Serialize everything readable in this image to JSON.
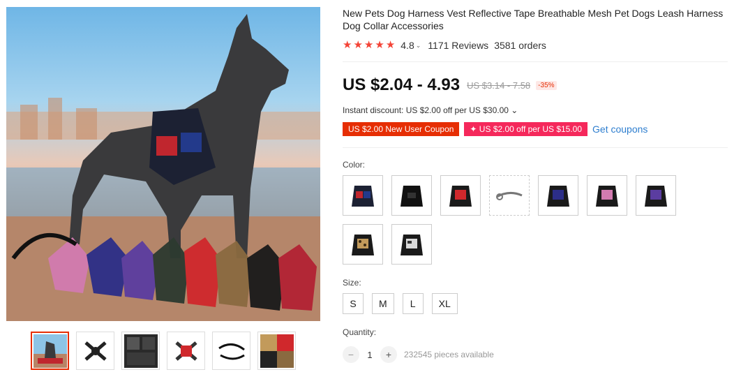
{
  "product": {
    "title": "New Pets Dog Harness Vest Reflective Tape Breathable Mesh Pet Dogs Leash Harness Dog Collar Accessories",
    "rating": "4.8",
    "reviews": "1171 Reviews",
    "orders": "3581 orders",
    "star_icon": "star-icon",
    "price": "US $2.04 - 4.93",
    "old_price": "US $3.14 - 7.58",
    "discount": "-35%",
    "instant_discount": "Instant discount: US $2.00 off per US $30.00 ⌄",
    "coupons": [
      "US $2.00 New User Coupon",
      "✦ US $2.00 off per US $15.00"
    ],
    "get_coupons": "Get coupons",
    "color_label": "Color:",
    "size_label": "Size:",
    "sizes": [
      "S",
      "M",
      "L",
      "XL"
    ],
    "quantity_label": "Quantity:",
    "quantity": "1",
    "available": "232545 pieces available",
    "minus": "−",
    "plus": "+"
  },
  "colors": {
    "accent": "#e62e04",
    "star": "#f44336",
    "link": "#2e7ecf"
  },
  "swatches": [
    "usa-flag",
    "black",
    "red",
    "leash",
    "blue",
    "pink",
    "purple",
    "leopard",
    "camo"
  ],
  "thumbnails": [
    "dog-harness-main",
    "harness-flat",
    "harness-collage",
    "harness-red-flat",
    "leash-black",
    "leopard-collage"
  ]
}
